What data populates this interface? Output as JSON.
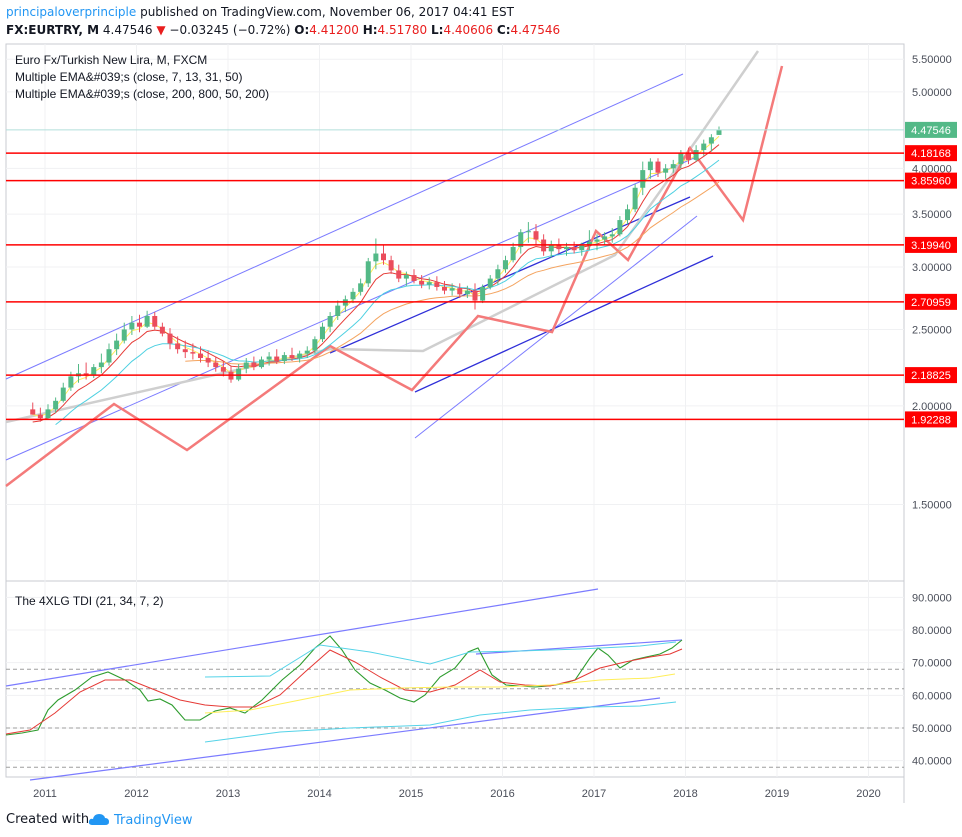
{
  "header": {
    "author": "principaloverprinciple",
    "published": "published on TradingView.com, November 06, 2017 04:41 EST",
    "symbol": "FX:EURTRY, M",
    "last": "4.47546",
    "change_arrow": "▼",
    "change": "−0.03245 (−0.72%)",
    "o_label": "O:",
    "o": "4.41200",
    "h_label": "H:",
    "h": "4.51780",
    "l_label": "L:",
    "l": "4.40606",
    "c_label": "C:",
    "c": "4.47546"
  },
  "legend": {
    "line1": "Euro Fx/Turkish New Lira, M, FXCM",
    "line2": "Multiple EMA&#039;s (close, 7, 13, 31, 50)",
    "line3": "Multiple EMA&#039;s (close, 200, 800, 50, 200)"
  },
  "tdi_legend": "The 4XLG TDI (21, 34, 7, 2)",
  "footer": {
    "created": "Created with",
    "brand": "TradingView"
  },
  "colors": {
    "up": "#53b987",
    "down": "#eb4d5c",
    "level": "#ff0000",
    "channel": "#7b7bff",
    "channel_dark": "#2f2fd8",
    "projection": "#f47a7a",
    "gray_path": "#cfcfcf",
    "ema_yellow": "#ffee58",
    "ema_red": "#e53935",
    "ema_cyan": "#4dd0e1",
    "ema_orange": "#f4a460",
    "tdi_green": "#2e9c2e",
    "tdi_cyan": "#55d3e8",
    "last_price": "#53b987"
  },
  "chart_data": {
    "type": "candlestick",
    "main": {
      "ylim": [
        1.2,
        5.75
      ],
      "y_ticks": [
        "1.50000",
        "2.00000",
        "2.50000",
        "3.00000",
        "3.50000",
        "4.00000",
        "5.00000",
        "5.50000"
      ],
      "x_ticks": [
        "2011",
        "2012",
        "2013",
        "2014",
        "2015",
        "2016",
        "2017",
        "2018",
        "2019",
        "2020"
      ],
      "horizontal_levels": [
        "4.18168",
        "3.85960",
        "3.19940",
        "2.70959",
        "2.18825",
        "1.92288"
      ],
      "last_price_label": "4.47546",
      "candles": [
        [
          1.98,
          2.02,
          1.95,
          1.95
        ],
        [
          1.95,
          1.99,
          1.91,
          1.93
        ],
        [
          1.93,
          2.01,
          1.92,
          1.98
        ],
        [
          1.98,
          2.05,
          1.96,
          2.03
        ],
        [
          2.03,
          2.14,
          2.02,
          2.11
        ],
        [
          2.11,
          2.21,
          2.09,
          2.18
        ],
        [
          2.18,
          2.26,
          2.14,
          2.2
        ],
        [
          2.2,
          2.27,
          2.16,
          2.19
        ],
        [
          2.19,
          2.26,
          2.17,
          2.24
        ],
        [
          2.24,
          2.33,
          2.2,
          2.27
        ],
        [
          2.27,
          2.4,
          2.25,
          2.36
        ],
        [
          2.36,
          2.47,
          2.32,
          2.42
        ],
        [
          2.42,
          2.55,
          2.4,
          2.5
        ],
        [
          2.5,
          2.6,
          2.46,
          2.55
        ],
        [
          2.55,
          2.61,
          2.48,
          2.52
        ],
        [
          2.52,
          2.64,
          2.51,
          2.6
        ],
        [
          2.6,
          2.63,
          2.5,
          2.52
        ],
        [
          2.52,
          2.55,
          2.45,
          2.47
        ],
        [
          2.47,
          2.51,
          2.36,
          2.4
        ],
        [
          2.4,
          2.45,
          2.33,
          2.36
        ],
        [
          2.36,
          2.42,
          2.3,
          2.34
        ],
        [
          2.34,
          2.4,
          2.29,
          2.33
        ],
        [
          2.33,
          2.38,
          2.27,
          2.3
        ],
        [
          2.3,
          2.35,
          2.24,
          2.27
        ],
        [
          2.27,
          2.31,
          2.21,
          2.24
        ],
        [
          2.24,
          2.28,
          2.18,
          2.21
        ],
        [
          2.21,
          2.25,
          2.14,
          2.16
        ],
        [
          2.16,
          2.26,
          2.15,
          2.23
        ],
        [
          2.23,
          2.3,
          2.2,
          2.27
        ],
        [
          2.27,
          2.31,
          2.22,
          2.24
        ],
        [
          2.24,
          2.31,
          2.23,
          2.29
        ],
        [
          2.29,
          2.34,
          2.25,
          2.31
        ],
        [
          2.31,
          2.36,
          2.26,
          2.28
        ],
        [
          2.28,
          2.34,
          2.26,
          2.32
        ],
        [
          2.32,
          2.37,
          2.28,
          2.3
        ],
        [
          2.3,
          2.35,
          2.27,
          2.33
        ],
        [
          2.33,
          2.38,
          2.3,
          2.35
        ],
        [
          2.35,
          2.45,
          2.33,
          2.43
        ],
        [
          2.43,
          2.55,
          2.41,
          2.52
        ],
        [
          2.52,
          2.63,
          2.48,
          2.6
        ],
        [
          2.6,
          2.72,
          2.57,
          2.68
        ],
        [
          2.68,
          2.76,
          2.63,
          2.73
        ],
        [
          2.73,
          2.82,
          2.7,
          2.79
        ],
        [
          2.79,
          2.9,
          2.76,
          2.86
        ],
        [
          2.86,
          3.08,
          2.83,
          3.05
        ],
        [
          3.05,
          3.26,
          2.98,
          3.12
        ],
        [
          3.12,
          3.2,
          3.02,
          3.06
        ],
        [
          3.06,
          3.1,
          2.94,
          2.97
        ],
        [
          2.97,
          3.02,
          2.87,
          2.9
        ],
        [
          2.9,
          2.96,
          2.84,
          2.93
        ],
        [
          2.93,
          2.98,
          2.86,
          2.88
        ],
        [
          2.88,
          2.93,
          2.82,
          2.85
        ],
        [
          2.85,
          2.91,
          2.81,
          2.87
        ],
        [
          2.87,
          2.92,
          2.8,
          2.83
        ],
        [
          2.83,
          2.88,
          2.77,
          2.8
        ],
        [
          2.8,
          2.86,
          2.76,
          2.82
        ],
        [
          2.82,
          2.86,
          2.74,
          2.77
        ],
        [
          2.77,
          2.84,
          2.74,
          2.8
        ],
        [
          2.8,
          2.86,
          2.65,
          2.72
        ],
        [
          2.72,
          2.85,
          2.7,
          2.83
        ],
        [
          2.83,
          2.93,
          2.81,
          2.9
        ],
        [
          2.9,
          3.02,
          2.85,
          2.98
        ],
        [
          2.98,
          3.1,
          2.95,
          3.06
        ],
        [
          3.06,
          3.22,
          3.04,
          3.18
        ],
        [
          3.18,
          3.35,
          3.12,
          3.32
        ],
        [
          3.32,
          3.42,
          3.22,
          3.33
        ],
        [
          3.33,
          3.4,
          3.2,
          3.25
        ],
        [
          3.25,
          3.3,
          3.1,
          3.14
        ],
        [
          3.14,
          3.24,
          3.08,
          3.2
        ],
        [
          3.2,
          3.26,
          3.12,
          3.16
        ],
        [
          3.16,
          3.22,
          3.1,
          3.18
        ],
        [
          3.18,
          3.23,
          3.12,
          3.15
        ],
        [
          3.15,
          3.22,
          3.1,
          3.2
        ],
        [
          3.2,
          3.34,
          3.15,
          3.23
        ],
        [
          3.23,
          3.3,
          3.15,
          3.25
        ],
        [
          3.25,
          3.32,
          3.2,
          3.28
        ],
        [
          3.28,
          3.36,
          3.22,
          3.3
        ],
        [
          3.3,
          3.48,
          3.28,
          3.44
        ],
        [
          3.44,
          3.6,
          3.4,
          3.55
        ],
        [
          3.55,
          3.82,
          3.52,
          3.78
        ],
        [
          3.78,
          4.08,
          3.7,
          3.98
        ],
        [
          3.98,
          4.12,
          3.88,
          4.08
        ],
        [
          4.08,
          4.12,
          3.9,
          3.95
        ],
        [
          3.95,
          4.05,
          3.88,
          4.0
        ],
        [
          4.0,
          4.1,
          3.95,
          4.05
        ],
        [
          4.05,
          4.22,
          4.0,
          4.18
        ],
        [
          4.18,
          4.25,
          4.05,
          4.1
        ],
        [
          4.1,
          4.28,
          4.08,
          4.22
        ],
        [
          4.22,
          4.35,
          4.15,
          4.3
        ],
        [
          4.3,
          4.42,
          4.2,
          4.38
        ],
        [
          4.41,
          4.52,
          4.41,
          4.48
        ]
      ]
    },
    "tdi": {
      "ylim": [
        35,
        95
      ],
      "y_ticks": [
        "40.0000",
        "50.0000",
        "60.0000",
        "70.0000",
        "80.0000",
        "90.0000"
      ],
      "dashed_levels": [
        68,
        62,
        50,
        38
      ]
    }
  }
}
